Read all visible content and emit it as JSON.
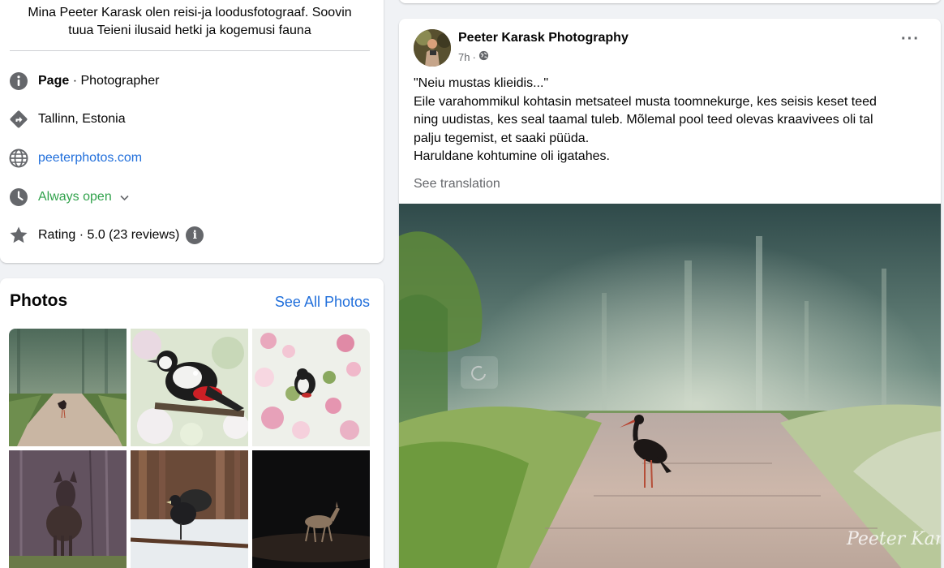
{
  "intro": {
    "bio_line1": "Mina Peeter Karask olen reisi-ja loodusfotograaf. Soovin",
    "bio_line2": "tuua Teieni ilusaid hetki ja kogemusi fauna",
    "category_label": "Page",
    "category_sep": " · ",
    "category_value": "Photographer",
    "location": "Tallinn, Estonia",
    "website": "peeterphotos.com",
    "hours": "Always open",
    "rating": "Rating · 5.0 (23 reviews)",
    "icons": [
      "info-icon",
      "directions-icon",
      "globe-icon",
      "clock-icon",
      "star-icon"
    ]
  },
  "photos": {
    "title": "Photos",
    "see_all": "See All Photos"
  },
  "post": {
    "author": "Peeter Karask Photography",
    "time": "7h",
    "dot": "·",
    "more": "···",
    "lines": [
      "\"Neiu mustas klieidis...\"",
      "Eile varahommikul kohtasin metsateel musta toomnekurge, kes seisis keset teed",
      "ning uudistas, kes seal taamal tuleb. Mõlemal pool teed olevas kraavivees oli tal",
      "palju tegemist, et saaki püüda.",
      "Haruldane kohtumine oli igatahes."
    ],
    "see_translation": "See translation",
    "watermark": "Peeter Karask"
  },
  "colors": {
    "link": "#216fdb",
    "open_green": "#31a24c",
    "secondary_text": "#65676b",
    "background": "#f0f2f5"
  }
}
